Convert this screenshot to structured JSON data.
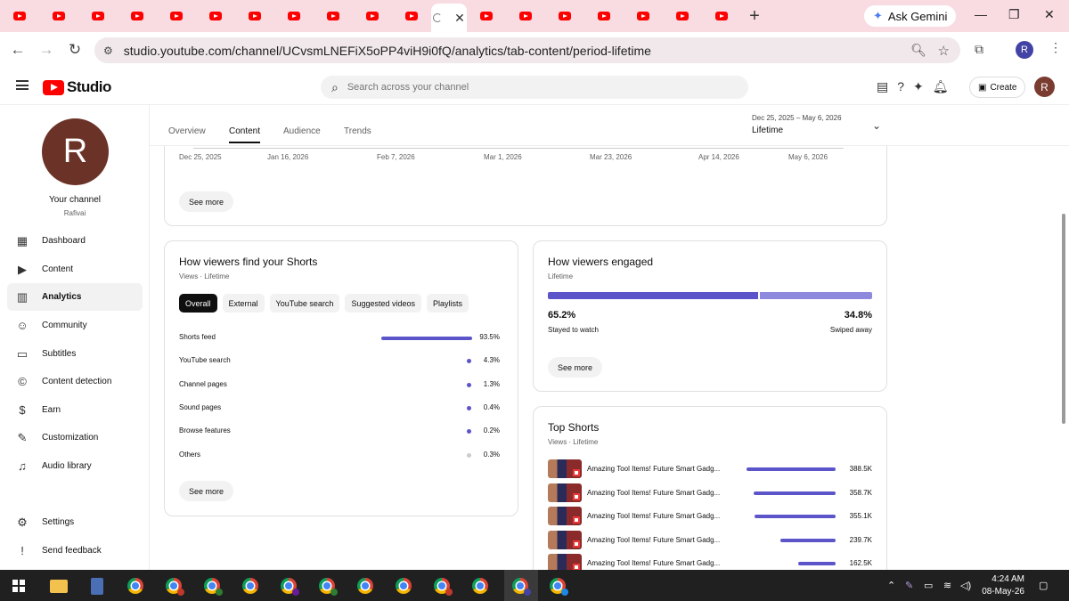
{
  "browser": {
    "gemini_label": "Ask Gemini",
    "url": "studio.youtube.com/channel/UCvsmLNEFiX5oPP4viH9i0fQ/analytics/tab-content/period-lifetime",
    "profile_initial": "R"
  },
  "header": {
    "logo_text": "Studio",
    "search_placeholder": "Search across your channel",
    "create_label": "Create",
    "avatar_initial": "R"
  },
  "sidebar": {
    "avatar_initial": "R",
    "channel_name": "Your channel",
    "channel_handle": "Rafivai",
    "items": [
      {
        "label": "Dashboard",
        "icon": "dashboard-icon"
      },
      {
        "label": "Content",
        "icon": "content-icon"
      },
      {
        "label": "Analytics",
        "icon": "analytics-icon",
        "active": true
      },
      {
        "label": "Community",
        "icon": "community-icon"
      },
      {
        "label": "Subtitles",
        "icon": "subtitles-icon"
      },
      {
        "label": "Content detection",
        "icon": "copyright-icon"
      },
      {
        "label": "Earn",
        "icon": "dollar-icon"
      },
      {
        "label": "Customization",
        "icon": "wand-icon"
      },
      {
        "label": "Audio library",
        "icon": "audio-library-icon"
      }
    ],
    "settings_label": "Settings",
    "feedback_label": "Send feedback"
  },
  "analytics": {
    "tabs": [
      "Overview",
      "Content",
      "Audience",
      "Trends"
    ],
    "active_tab": "Content",
    "date_range": "Dec 25, 2025 – May 6, 2026",
    "period_label": "Lifetime",
    "timeline_ticks": [
      "Dec 25, 2025",
      "Jan 16, 2026",
      "Feb 7, 2026",
      "Mar 1, 2026",
      "Mar 23, 2026",
      "Apr 14, 2026",
      "May 6, 2026"
    ],
    "see_more": "See more"
  },
  "traffic": {
    "title": "How viewers find your Shorts",
    "subtitle": "Views · Lifetime",
    "chips": [
      "Overall",
      "External",
      "YouTube search",
      "Suggested videos",
      "Playlists"
    ],
    "active_chip": "Overall",
    "sources": [
      {
        "label": "Shorts feed",
        "value": "93.5%",
        "percent": 93.5
      },
      {
        "label": "YouTube search",
        "value": "4.3%",
        "percent": 4.3
      },
      {
        "label": "Channel pages",
        "value": "1.3%",
        "percent": 1.3
      },
      {
        "label": "Sound pages",
        "value": "0.4%",
        "percent": 0.4
      },
      {
        "label": "Browse features",
        "value": "0.2%",
        "percent": 0.2
      },
      {
        "label": "Others",
        "value": "0.3%",
        "percent": 0.3
      }
    ],
    "see_more": "See more"
  },
  "engagement": {
    "title": "How viewers engaged",
    "subtitle": "Lifetime",
    "stayed_pct": "65.2%",
    "stayed_label": "Stayed to watch",
    "swiped_pct": "34.8%",
    "swiped_label": "Swiped away",
    "stayed_value": 65.2,
    "see_more": "See more"
  },
  "top_shorts": {
    "title": "Top Shorts",
    "subtitle": "Views · Lifetime",
    "items": [
      {
        "title": "Amazing Tool Items! Future Smart Gadg...",
        "views": "388.5K",
        "value": 388.5
      },
      {
        "title": "Amazing Tool Items! Future Smart Gadg...",
        "views": "358.7K",
        "value": 358.7
      },
      {
        "title": "Amazing Tool Items! Future Smart Gadg...",
        "views": "355.1K",
        "value": 355.1
      },
      {
        "title": "Amazing Tool Items! Future Smart Gadg...",
        "views": "239.7K",
        "value": 239.7
      },
      {
        "title": "Amazing Tool Items! Future Smart Gadg...",
        "views": "162.5K",
        "value": 162.5
      }
    ]
  },
  "taskbar": {
    "time": "4:24 AM",
    "date": "08-May-26"
  },
  "colors": {
    "accent": "#5b55c9",
    "accent_light": "#8d89dd",
    "youtube_red": "#ff0000",
    "tabstrip": "#f9dbe2"
  }
}
